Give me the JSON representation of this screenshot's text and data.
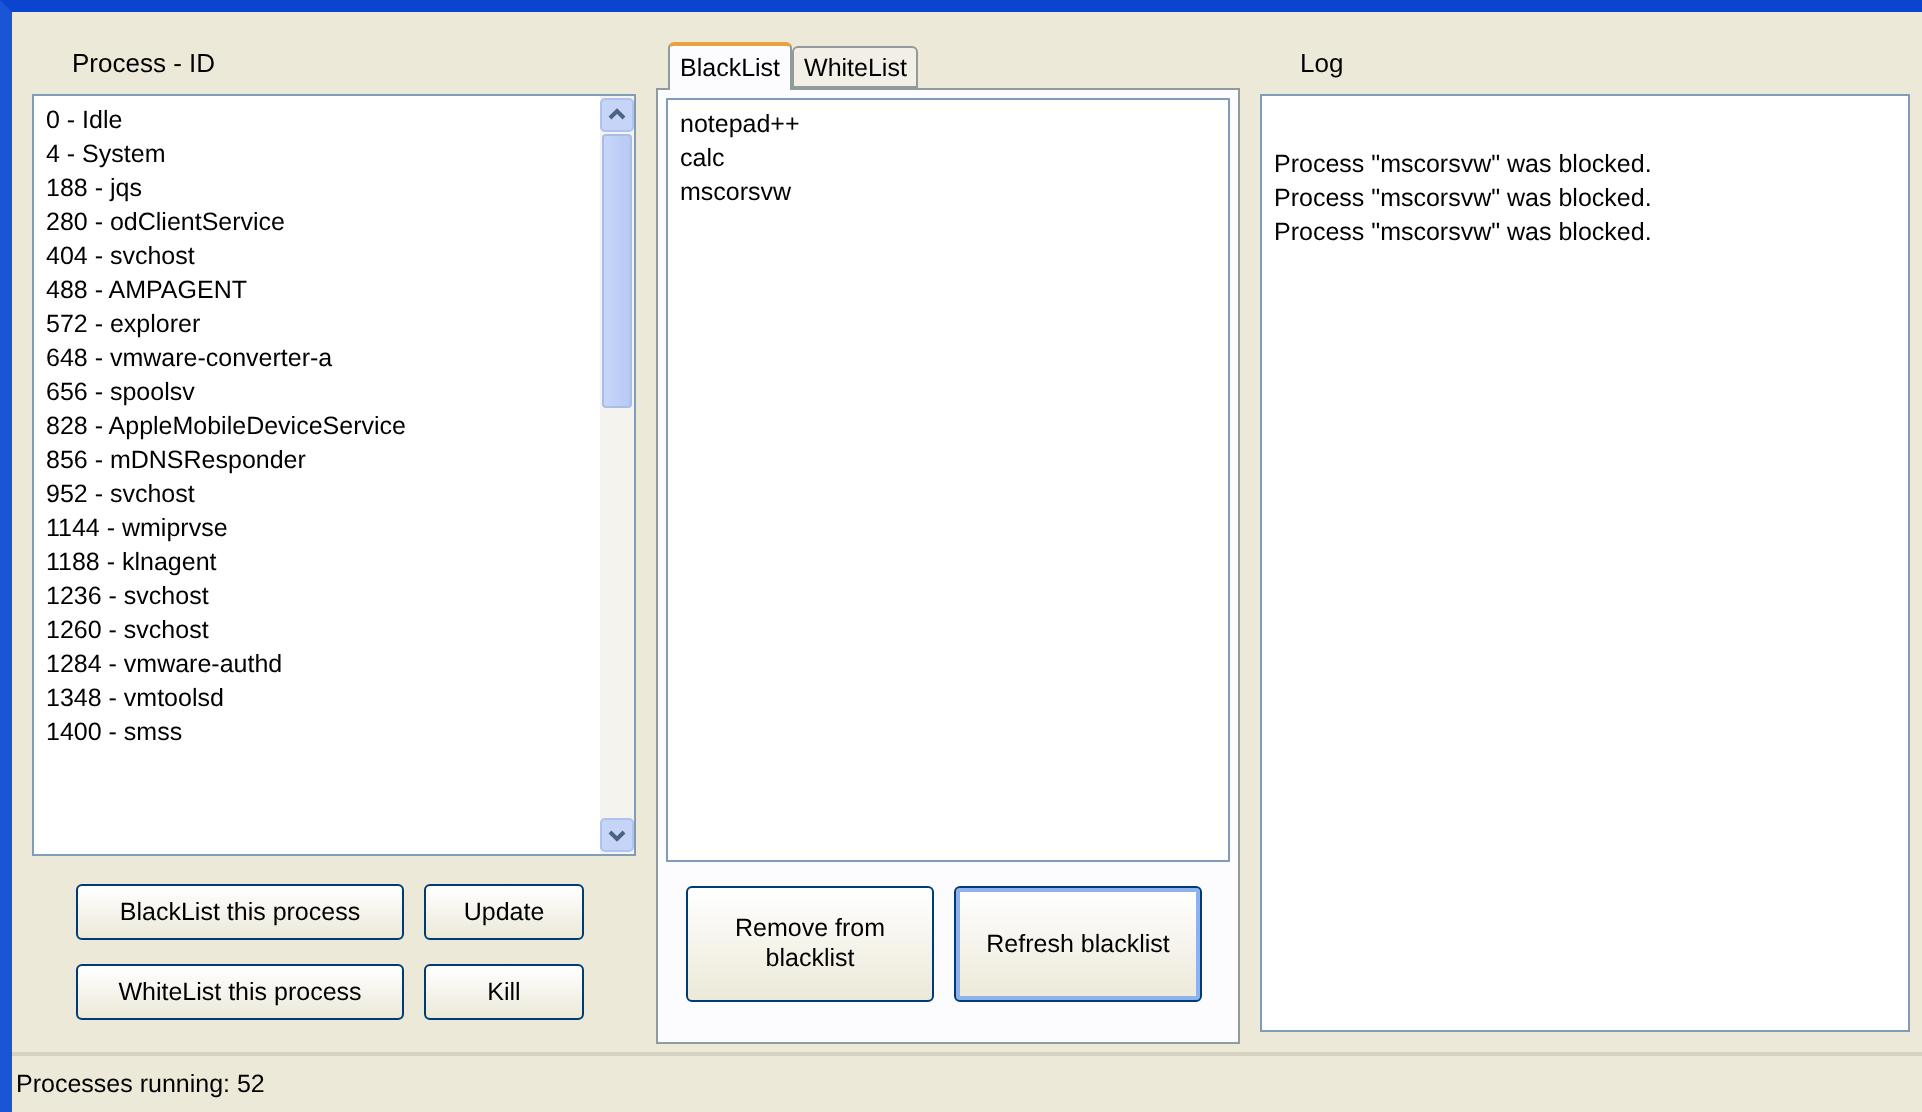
{
  "process_panel": {
    "title": "Process - ID",
    "processes": [
      "0 - Idle",
      "4 - System",
      "188 - jqs",
      "280 - odClientService",
      "404 - svchost",
      "488 - AMPAGENT",
      "572 - explorer",
      "648 - vmware-converter-a",
      "656 - spoolsv",
      "828 - AppleMobileDeviceService",
      "856 - mDNSResponder",
      "952 - svchost",
      "1144 - wmiprvse",
      "1188 - klnagent",
      "1236 - svchost",
      "1260 - svchost",
      "1284 - vmware-authd",
      "1348 - vmtoolsd",
      "1400 - smss"
    ],
    "buttons": [
      {
        "label": "BlackList this process"
      },
      {
        "label": "Update"
      },
      {
        "label": "WhiteList this process"
      },
      {
        "label": "Kill"
      }
    ]
  },
  "list_panel": {
    "tabs": [
      {
        "label": "BlackList",
        "selected": true
      },
      {
        "label": "WhiteList",
        "selected": false
      }
    ],
    "items": [
      "notepad++",
      "calc",
      "mscorsvw"
    ],
    "buttons": [
      {
        "label": "Remove from blacklist",
        "default": false
      },
      {
        "label": "Refresh blacklist",
        "default": true
      }
    ]
  },
  "log_panel": {
    "title": "Log",
    "lines": [
      "Process \"mscorsvw\" was blocked.",
      "Process \"mscorsvw\" was blocked.",
      "Process \"mscorsvw\" was blocked."
    ]
  },
  "status_bar": {
    "text": "Processes running: 52"
  }
}
